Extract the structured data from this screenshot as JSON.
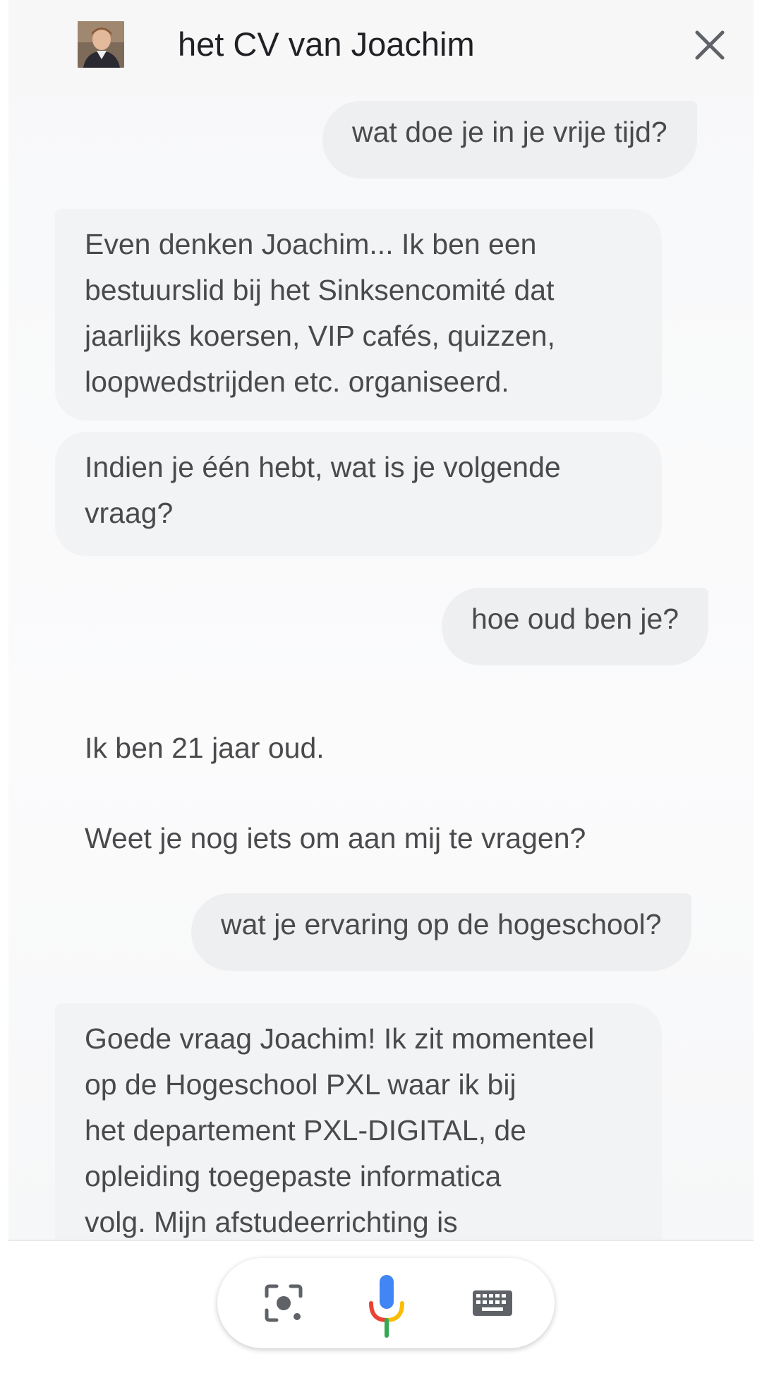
{
  "header": {
    "title": "het CV van Joachim",
    "avatar_icon": "profile-photo",
    "close_icon": "close-icon"
  },
  "messages": [
    {
      "role": "user",
      "text": "wat doe je in je vrije tijd?"
    },
    {
      "role": "bot",
      "lines": [
        "Even denken Joachim... Ik ben een",
        "bestuurslid bij het Sinksencomité dat",
        "jaarlijks koersen, VIP cafés, quizzen,",
        "loopwedstrijden etc. organiseerd."
      ]
    },
    {
      "role": "bot",
      "lines": [
        "Indien je één hebt, wat is je volgende",
        "vraag?"
      ]
    },
    {
      "role": "user",
      "text": "hoe oud ben je?"
    },
    {
      "role": "bot",
      "lines": [
        "Ik ben 21 jaar oud."
      ]
    },
    {
      "role": "bot",
      "lines": [
        "Weet je nog iets om aan mij te vragen?"
      ]
    },
    {
      "role": "user",
      "text": "wat je ervaring op de hogeschool?"
    },
    {
      "role": "bot",
      "lines": [
        "Goede vraag Joachim! Ik zit momenteel",
        "op de Hogeschool PXL waar ik bij",
        "het departement PXL-DIGITAL, de",
        "opleiding toegepaste informatica",
        "volg. Mijn afstudeerrichting is"
      ]
    }
  ],
  "input_bar": {
    "lens_icon": "lens-icon",
    "mic_icon": "microphone-icon",
    "keyboard_icon": "keyboard-icon"
  },
  "colors": {
    "mic_blue": "#4285f4",
    "mic_red": "#ea4335",
    "mic_yellow": "#fbbc05",
    "mic_green": "#34a853",
    "user_bubble": "#eeeff1",
    "bot_bubble": "#f2f3f5",
    "text": "#4a4a4d"
  }
}
